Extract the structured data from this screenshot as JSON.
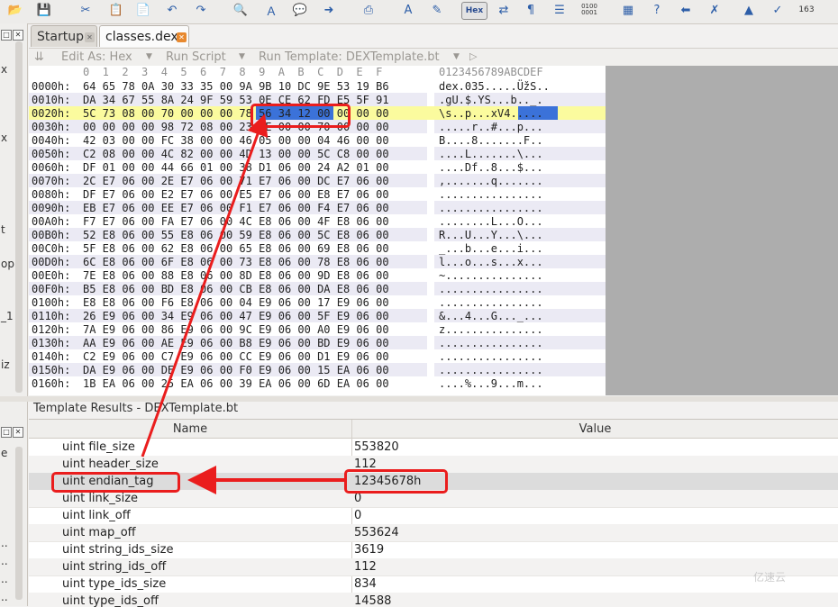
{
  "toolbar": {
    "hex_label": "Hex",
    "icons": [
      "open-folder-icon",
      "cut-icon",
      "copy-icon",
      "paste-icon",
      "undo-icon",
      "redo-icon",
      "find-icon",
      "replace-icon",
      "find-in-files-icon",
      "goto-icon",
      "print-icon",
      "font-icon",
      "highlight-icon",
      "hex-toggle-icon",
      "hex-ruler-icon",
      "paragraph-icon",
      "columns-icon",
      "binary-icon",
      "calculator-icon",
      "help-icon",
      "import-icon",
      "compare-icon",
      "histogram-icon",
      "check-icon",
      "bookmark-icon"
    ],
    "binary_label": "0100\n0001",
    "counter_label": "163"
  },
  "tabs": [
    {
      "label": "Startup"
    },
    {
      "label": "classes.dex"
    }
  ],
  "editor_bar": {
    "edit_as": "Edit As: Hex",
    "run_script": "Run Script",
    "run_template": "Run Template: DEXTemplate.bt"
  },
  "hex_view": {
    "column_header": "0  1  2  3  4  5  6  7  8  9  A  B  C  D  E  F",
    "ascii_header": "0123456789ABCDEF",
    "rows": [
      {
        "offset": "0000h:",
        "bytes": "64 65 78 0A 30 33 35 00 9A 9B 10 DC 9E 53 19 B6",
        "ascii": "dex.035.....ÜžS.."
      },
      {
        "offset": "0010h:",
        "bytes": "DA 34 67 55 8A 24 9F 59 53 0E CE 62 FD E5 5F 91",
        "ascii": ".gU.$.YS...b.._."
      },
      {
        "offset": "0020h:",
        "bytes": "5C 73 08 00 70 00 00 00 78 56 34 12 00 00 00 00",
        "ascii": "\\s..p...xV4....."
      },
      {
        "offset": "0030h:",
        "bytes": "00 00 00 00 98 72 08 00 23 0E 00 00 70 00 00 00",
        "ascii": ".....r..#...p..."
      },
      {
        "offset": "0040h:",
        "bytes": "42 03 00 00 FC 38 00 00 46 05 00 00 04 46 00 00",
        "ascii": "B....8.......F.."
      },
      {
        "offset": "0050h:",
        "bytes": "C2 08 00 00 4C 82 00 00 4D 13 00 00 5C C8 00 00",
        "ascii": "....L.......\\..."
      },
      {
        "offset": "0060h:",
        "bytes": "DF 01 00 00 44 66 01 00 38 D1 06 00 24 A2 01 00",
        "ascii": "....Df..8...$..."
      },
      {
        "offset": "0070h:",
        "bytes": "2C E7 06 00 2E E7 06 00 71 E7 06 00 DC E7 06 00",
        "ascii": ",.......q......."
      },
      {
        "offset": "0080h:",
        "bytes": "DF E7 06 00 E2 E7 06 00 E5 E7 06 00 E8 E7 06 00",
        "ascii": "................"
      },
      {
        "offset": "0090h:",
        "bytes": "EB E7 06 00 EE E7 06 00 F1 E7 06 00 F4 E7 06 00",
        "ascii": "................"
      },
      {
        "offset": "00A0h:",
        "bytes": "F7 E7 06 00 FA E7 06 00 4C E8 06 00 4F E8 06 00",
        "ascii": "........L...O..."
      },
      {
        "offset": "00B0h:",
        "bytes": "52 E8 06 00 55 E8 06 00 59 E8 06 00 5C E8 06 00",
        "ascii": "R...U...Y...\\..."
      },
      {
        "offset": "00C0h:",
        "bytes": "5F E8 06 00 62 E8 06 00 65 E8 06 00 69 E8 06 00",
        "ascii": "_...b...e...i..."
      },
      {
        "offset": "00D0h:",
        "bytes": "6C E8 06 00 6F E8 06 00 73 E8 06 00 78 E8 06 00",
        "ascii": "l...o...s...x..."
      },
      {
        "offset": "00E0h:",
        "bytes": "7E E8 06 00 88 E8 06 00 8D E8 06 00 9D E8 06 00",
        "ascii": "~..............."
      },
      {
        "offset": "00F0h:",
        "bytes": "B5 E8 06 00 BD E8 06 00 CB E8 06 00 DA E8 06 00",
        "ascii": "................"
      },
      {
        "offset": "0100h:",
        "bytes": "E8 E8 06 00 F6 E8 06 00 04 E9 06 00 17 E9 06 00",
        "ascii": "................"
      },
      {
        "offset": "0110h:",
        "bytes": "26 E9 06 00 34 E9 06 00 47 E9 06 00 5F E9 06 00",
        "ascii": "&...4...G..._..."
      },
      {
        "offset": "0120h:",
        "bytes": "7A E9 06 00 86 E9 06 00 9C E9 06 00 A0 E9 06 00",
        "ascii": "z..............."
      },
      {
        "offset": "0130h:",
        "bytes": "AA E9 06 00 AE E9 06 00 B8 E9 06 00 BD E9 06 00",
        "ascii": "................"
      },
      {
        "offset": "0140h:",
        "bytes": "C2 E9 06 00 C7 E9 06 00 CC E9 06 00 D1 E9 06 00",
        "ascii": "................"
      },
      {
        "offset": "0150h:",
        "bytes": "DA E9 06 00 DE E9 06 00 F0 E9 06 00 15 EA 06 00",
        "ascii": "................"
      },
      {
        "offset": "0160h:",
        "bytes": "1B EA 06 00 25 EA 06 00 39 EA 06 00 6D EA 06 00",
        "ascii": "....%...9...m..."
      }
    ]
  },
  "template_results": {
    "title": "Template Results - DEXTemplate.bt",
    "col_name": "Name",
    "col_value": "Value",
    "rows": [
      {
        "name": "uint file_size",
        "value": "553820"
      },
      {
        "name": "uint header_size",
        "value": "112"
      },
      {
        "name": "uint endian_tag",
        "value": "12345678h"
      },
      {
        "name": "uint link_size",
        "value": "0"
      },
      {
        "name": "uint link_off",
        "value": "0"
      },
      {
        "name": "uint map_off",
        "value": "553624"
      },
      {
        "name": "uint string_ids_size",
        "value": "3619"
      },
      {
        "name": "uint string_ids_off",
        "value": "112"
      },
      {
        "name": "uint type_ids_size",
        "value": "834"
      },
      {
        "name": "uint type_ids_off",
        "value": "14588"
      }
    ]
  },
  "left_panel": {
    "fragments": [
      "x",
      "x",
      "t",
      "op",
      "_1",
      "iz",
      "e",
      "..",
      "..",
      "..",
      ".."
    ]
  },
  "annotation": {
    "color": "#ea1d1d"
  },
  "watermark": "亿速云"
}
